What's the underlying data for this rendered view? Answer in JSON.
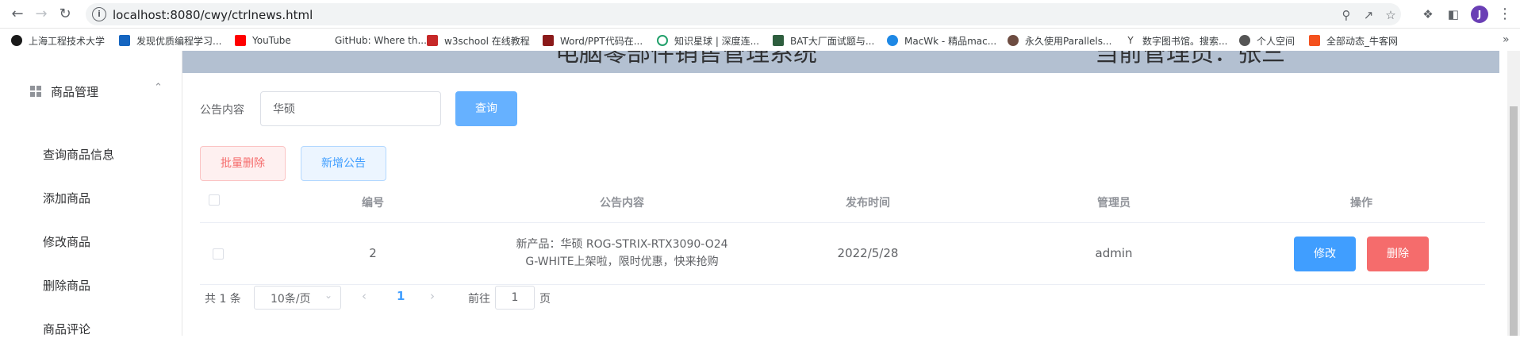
{
  "browser": {
    "url": "localhost:8080/cwy/ctrlnews.html",
    "avatar_letter": "J",
    "bookmarks": [
      {
        "label": "上海工程技术大学",
        "color": "#1a1a1a"
      },
      {
        "label": "发现优质编程学习...",
        "color": "#1565c0"
      },
      {
        "label": "YouTube",
        "color": "#ff0000"
      },
      {
        "label": "GitHub: Where th...",
        "color": "#ffffff"
      },
      {
        "label": "w3school 在线教程",
        "color": "#c62828"
      },
      {
        "label": "Word/PPT代码在...",
        "color": "#8b1a1a"
      },
      {
        "label": "知识星球 | 深度连...",
        "color": "#22a06b"
      },
      {
        "label": "BAT大厂面试题与...",
        "color": "#2e5e3e"
      },
      {
        "label": "MacWk - 精品mac...",
        "color": "#1e88e5"
      },
      {
        "label": "永久使用Parallels...",
        "color": "#6d4c41"
      },
      {
        "label": "数字图书馆。搜索...",
        "color": "#444444"
      },
      {
        "label": "个人空间",
        "color": "#555555"
      },
      {
        "label": "全部动态_牛客网",
        "color": "#f4511e"
      }
    ]
  },
  "header": {
    "system_title": "电脑零部件销售管理系统",
    "admin_text": "当前管理员：张三"
  },
  "sidebar": {
    "group_title": "商品管理",
    "items": [
      {
        "label": "查询商品信息"
      },
      {
        "label": "添加商品"
      },
      {
        "label": "修改商品"
      },
      {
        "label": "删除商品"
      },
      {
        "label": "商品评论"
      }
    ]
  },
  "search": {
    "label": "公告内容",
    "value": "华硕",
    "query_button": "查询"
  },
  "actions": {
    "batch_delete": "批量删除",
    "add_notice": "新增公告"
  },
  "table": {
    "headers": {
      "id": "编号",
      "content": "公告内容",
      "date": "发布时间",
      "admin": "管理员",
      "ops": "操作"
    },
    "rows": [
      {
        "id": "2",
        "content_line1": "新产品：华硕 ROG-STRIX-RTX3090-O24",
        "content_line2": "G-WHITE上架啦，限时优惠，快来抢购",
        "date": "2022/5/28",
        "admin": "admin",
        "edit_label": "修改",
        "delete_label": "删除"
      }
    ]
  },
  "pagination": {
    "total": "共 1 条",
    "page_size": "10条/页",
    "current_page": "1",
    "goto_label": "前往",
    "goto_value": "1",
    "page_unit": "页"
  }
}
